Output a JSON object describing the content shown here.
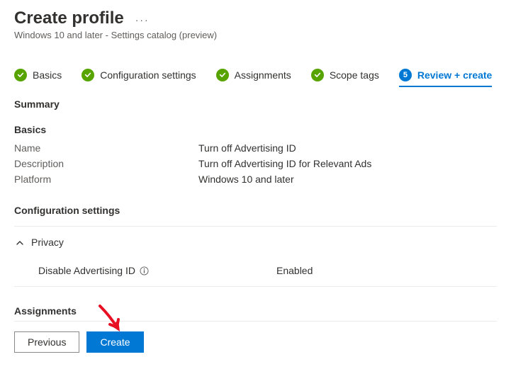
{
  "header": {
    "title": "Create profile",
    "subtitle": "Windows 10 and later - Settings catalog (preview)"
  },
  "stepper": {
    "steps": [
      {
        "label": "Basics",
        "state": "complete"
      },
      {
        "label": "Configuration settings",
        "state": "complete"
      },
      {
        "label": "Assignments",
        "state": "complete"
      },
      {
        "label": "Scope tags",
        "state": "complete"
      },
      {
        "label": "Review + create",
        "state": "current",
        "number": "5"
      }
    ]
  },
  "summary": {
    "heading": "Summary",
    "basics": {
      "heading": "Basics",
      "rows": [
        {
          "key": "Name",
          "value": "Turn off Advertising ID"
        },
        {
          "key": "Description",
          "value": "Turn off Advertising ID for Relevant Ads"
        },
        {
          "key": "Platform",
          "value": "Windows 10 and later"
        }
      ]
    },
    "config": {
      "heading": "Configuration settings",
      "group": "Privacy",
      "settings": [
        {
          "name": "Disable Advertising ID",
          "value": "Enabled"
        }
      ]
    },
    "assignments": {
      "heading": "Assignments"
    }
  },
  "footer": {
    "previous": "Previous",
    "create": "Create"
  }
}
